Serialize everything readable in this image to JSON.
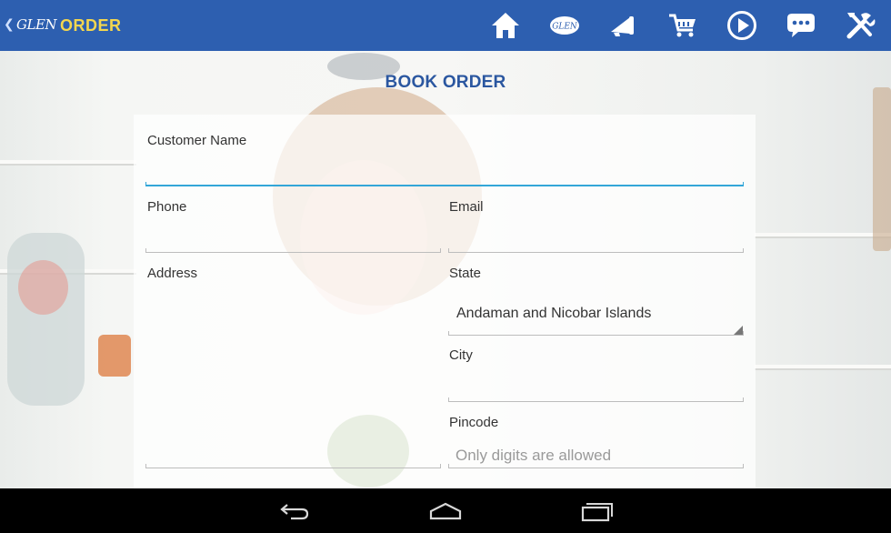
{
  "appbar": {
    "back_icon": "chevron-left-icon",
    "logo_text": "GLEN",
    "title": "ORDER",
    "actions": [
      {
        "icon": "home-icon"
      },
      {
        "icon": "glen-logo-icon",
        "text": "GLEN"
      },
      {
        "icon": "megaphone-icon"
      },
      {
        "icon": "cart-icon"
      },
      {
        "icon": "play-icon"
      },
      {
        "icon": "chat-icon"
      },
      {
        "icon": "tools-icon"
      }
    ],
    "colors": {
      "bar": "#2d5fb0",
      "title": "#f3d64f"
    }
  },
  "form": {
    "title": "BOOK ORDER",
    "customer_name": {
      "label": "Customer Name",
      "value": ""
    },
    "phone": {
      "label": "Phone",
      "value": ""
    },
    "email": {
      "label": "Email",
      "value": ""
    },
    "address": {
      "label": "Address",
      "value": ""
    },
    "state": {
      "label": "State",
      "value": "Andaman and Nicobar Islands"
    },
    "city": {
      "label": "City",
      "value": ""
    },
    "pincode": {
      "label": "Pincode",
      "placeholder": "Only digits are allowed",
      "value": ""
    },
    "colors": {
      "title": "#2b57a0",
      "active_underline": "#33a6d8"
    }
  },
  "navbar": {
    "buttons": [
      {
        "icon": "back-icon"
      },
      {
        "icon": "home-outline-icon"
      },
      {
        "icon": "recent-apps-icon"
      }
    ]
  }
}
